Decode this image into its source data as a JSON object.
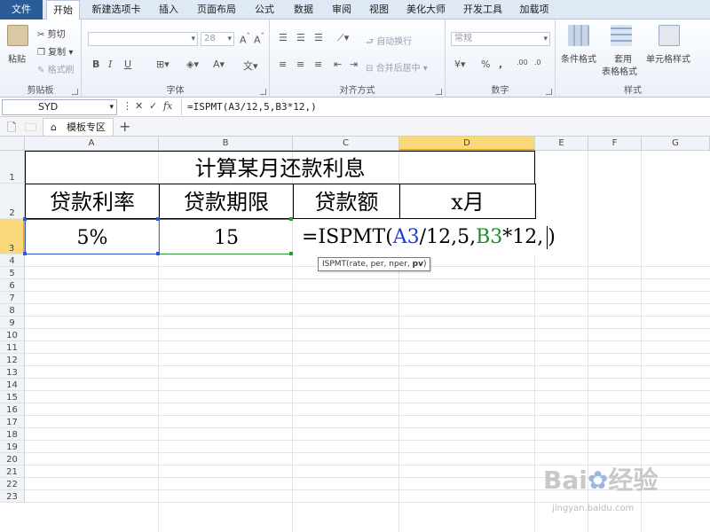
{
  "tabs": [
    "文件",
    "开始",
    "新建选项卡",
    "插入",
    "页面布局",
    "公式",
    "数据",
    "审阅",
    "视图",
    "美化大师",
    "开发工具",
    "加载项"
  ],
  "ribbon": {
    "clipboard": {
      "paste": "粘贴",
      "cut": "剪切",
      "copy": "复制",
      "format_painter": "格式刷",
      "label": "剪贴板"
    },
    "font": {
      "font_size": "28",
      "label": "字体",
      "bold": "B",
      "italic": "I",
      "underline": "U"
    },
    "alignment": {
      "wrap": "自动换行",
      "merge": "合并后居中",
      "label": "对齐方式"
    },
    "number": {
      "format": "常规",
      "percent": "%",
      "comma": ",",
      "label": "数字"
    },
    "styles": {
      "conditional": "条件格式",
      "table_fmt_1": "套用",
      "table_fmt_2": "表格格式",
      "cell_style": "单元格样式",
      "label": "样式"
    }
  },
  "formula_bar": {
    "name_box": "SYD",
    "fx": "fx",
    "formula": "=ISPMT(A3/12,5,B3*12,)"
  },
  "doc_tab": "模板专区",
  "columns": [
    "A",
    "B",
    "C",
    "D",
    "E",
    "F",
    "G"
  ],
  "rows": [
    "1",
    "2",
    "3",
    "4",
    "5",
    "6",
    "7",
    "8",
    "9",
    "10",
    "11",
    "12",
    "13",
    "14",
    "15",
    "16",
    "17",
    "18",
    "19",
    "20",
    "21",
    "22",
    "23"
  ],
  "sheet": {
    "title": "计算某月还款利息",
    "headers": [
      "贷款利率",
      "贷款期限",
      "贷款额",
      "x月"
    ],
    "values": [
      "5%",
      "15"
    ],
    "edit": {
      "prefix": "=ISPMT(",
      "ref1": "A3",
      "part2": "/12,5,",
      "ref2": "B3",
      "part3": "*12,",
      "suffix": ")"
    },
    "tooltip": "ISPMT(rate, per, nper, ",
    "tooltip_bold": "pv",
    "tooltip_end": ")"
  },
  "colors": {
    "ref1": "#1f3bd1",
    "ref2": "#1d8a2a",
    "selection": "#f9d97a"
  },
  "watermark": {
    "brand": "Bai",
    "brand2": "经验",
    "url": "jingyan.baidu.com"
  }
}
